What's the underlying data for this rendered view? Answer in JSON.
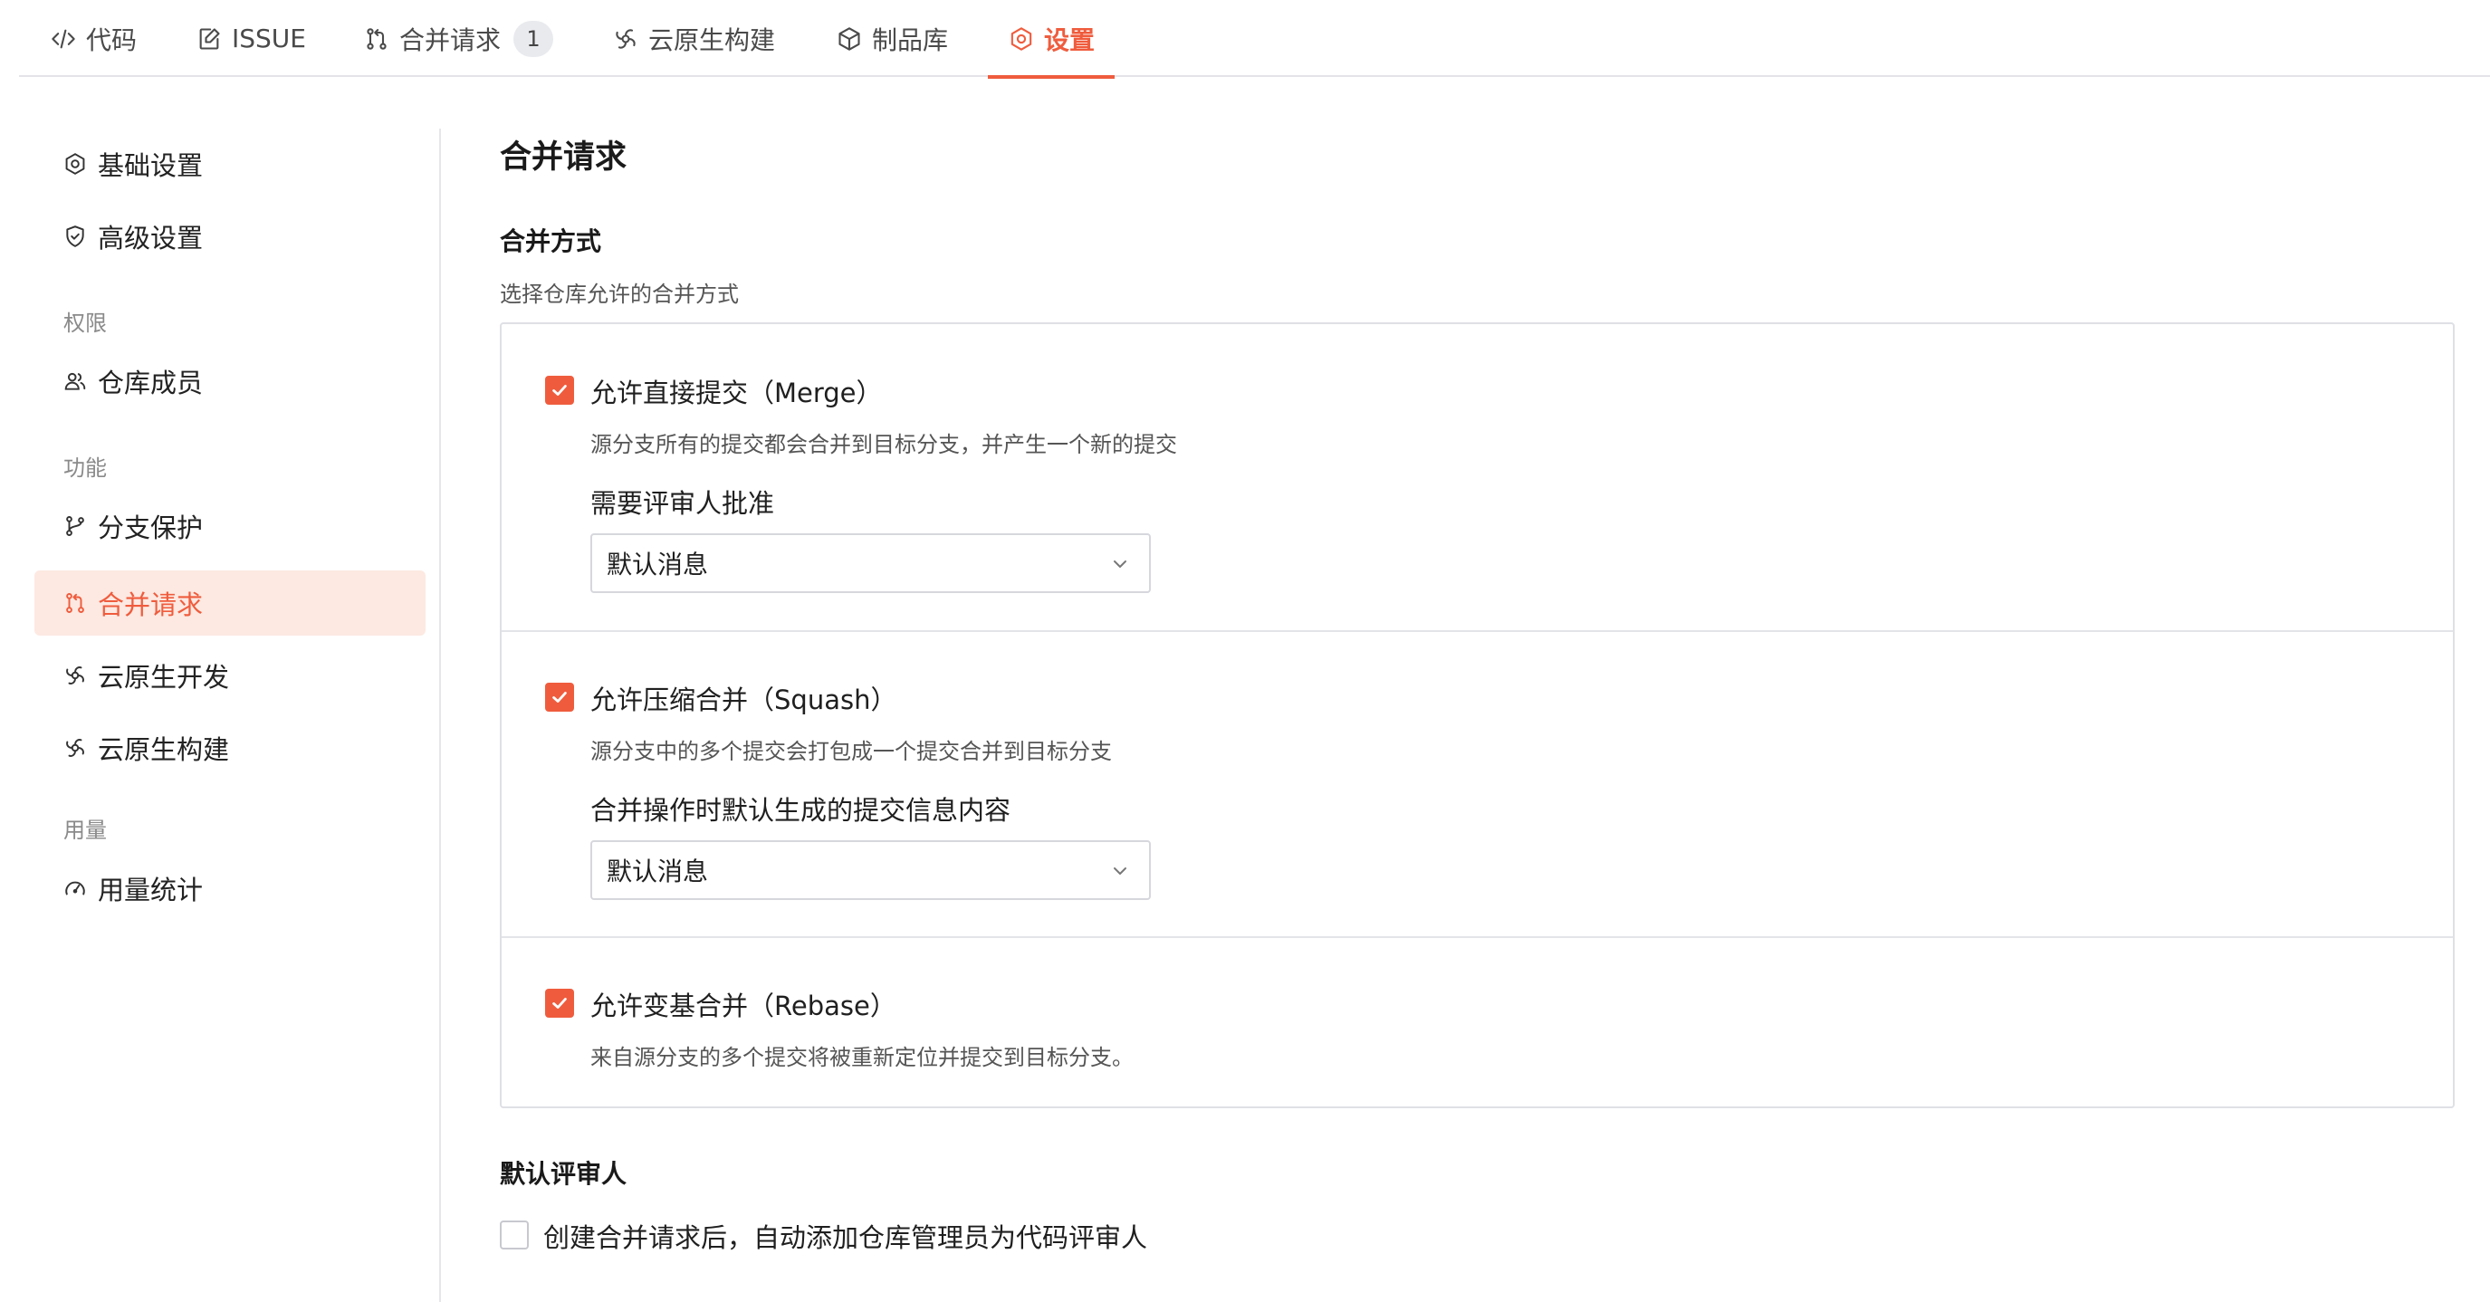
{
  "colors": {
    "accent": "#ef5c3d",
    "accent_bg": "#fde9e2",
    "border": "#dfe0e5",
    "muted_text": "#8a8a8a"
  },
  "tabs": [
    {
      "label": "代码",
      "icon": "code-icon"
    },
    {
      "label": "ISSUE",
      "icon": "issue-icon"
    },
    {
      "label": "合并请求",
      "icon": "merge-request-icon",
      "badge": "1"
    },
    {
      "label": "云原生构建",
      "icon": "cloud-native-build-icon"
    },
    {
      "label": "制品库",
      "icon": "package-icon"
    },
    {
      "label": "设置",
      "icon": "settings-icon",
      "active": true
    }
  ],
  "sidebar": {
    "items": [
      {
        "label": "基础设置",
        "icon": "settings-icon"
      },
      {
        "label": "高级设置",
        "icon": "shield-icon"
      },
      {
        "label": "仓库成员",
        "icon": "members-icon"
      },
      {
        "label": "分支保护",
        "icon": "branch-icon"
      },
      {
        "label": "合并请求",
        "icon": "merge-request-icon",
        "active": true
      },
      {
        "label": "云原生开发",
        "icon": "cloud-native-dev-icon"
      },
      {
        "label": "云原生构建",
        "icon": "cloud-native-build-icon"
      },
      {
        "label": "用量统计",
        "icon": "gauge-icon"
      }
    ],
    "groups": {
      "permissions": "权限",
      "features": "功能",
      "usage": "用量"
    }
  },
  "main": {
    "title": "合并请求",
    "merge_method": {
      "title": "合并方式",
      "description": "选择仓库允许的合并方式",
      "options": [
        {
          "title": "允许直接提交（Merge）",
          "description": "源分支所有的提交都会合并到目标分支，并产生一个新的提交",
          "checked": true,
          "sub_label": "需要评审人批准",
          "select_value": "默认消息"
        },
        {
          "title": "允许压缩合并（Squash）",
          "description": "源分支中的多个提交会打包成一个提交合并到目标分支",
          "checked": true,
          "sub_label": "合并操作时默认生成的提交信息内容",
          "select_value": "默认消息"
        },
        {
          "title": "允许变基合并（Rebase）",
          "description": "来自源分支的多个提交将被重新定位并提交到目标分支。",
          "checked": true
        }
      ]
    },
    "default_reviewer": {
      "title": "默认评审人",
      "checkbox_label": "创建合并请求后，自动添加仓库管理员为代码评审人",
      "checked": false
    }
  }
}
